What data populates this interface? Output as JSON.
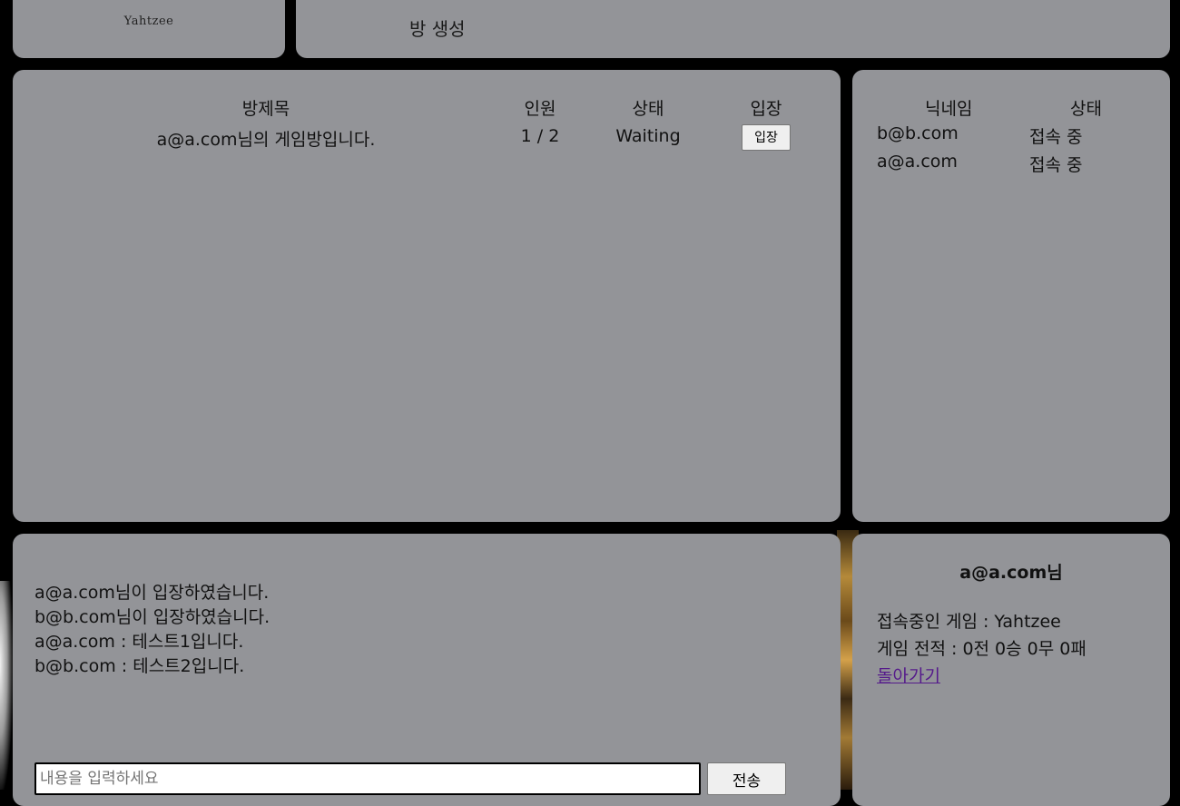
{
  "header": {
    "logo_text": "Yahtzee",
    "create_room_label": "방 생성"
  },
  "room_list": {
    "headers": {
      "title": "방제목",
      "count": "인원",
      "status": "상태",
      "enter": "입장"
    },
    "rooms": [
      {
        "title": "a@a.com님의 게임방입니다.",
        "count": "1 / 2",
        "status": "Waiting",
        "enter_label": "입장"
      }
    ]
  },
  "user_list": {
    "headers": {
      "nickname": "닉네임",
      "status": "상태"
    },
    "users": [
      {
        "nickname": "b@b.com",
        "status": "접속 중"
      },
      {
        "nickname": "a@a.com",
        "status": "접속 중"
      }
    ]
  },
  "chat": {
    "messages": [
      "a@a.com님이 입장하였습니다.",
      "b@b.com님이 입장하였습니다.",
      "a@a.com : 테스트1입니다.",
      "b@b.com : 테스트2입니다."
    ],
    "input_value": "",
    "input_placeholder": "내용을 입력하세요",
    "send_label": "전송"
  },
  "profile": {
    "name": "a@a.com님",
    "current_game": "접속중인 게임 : Yahtzee",
    "record": "게임 전적 : 0전 0승 0무 0패",
    "back_label": "돌아가기"
  },
  "colors": {
    "background": "#000000",
    "panel": "#939498",
    "link_visited": "#551a8b"
  }
}
